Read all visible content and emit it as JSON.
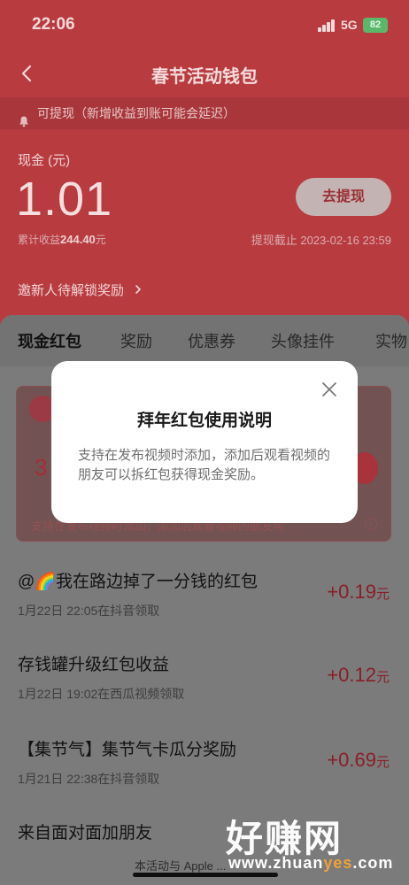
{
  "status_bar": {
    "time": "22:06",
    "network": "5G",
    "battery": "82"
  },
  "nav": {
    "title": "春节活动钱包"
  },
  "notice": {
    "text": "可提现（新增收益到账可能会延迟）"
  },
  "wallet": {
    "cash_label": "现金 (元)",
    "cash_amount": "1.01",
    "withdraw_label": "去提现",
    "total_label": "累计收益",
    "total_value": "244.40",
    "total_unit": "元",
    "deadline": "提现截止 2023-02-16 23:59",
    "invite": "邀新人待解锁奖励"
  },
  "tabs": [
    "现金红包",
    "奖励",
    "优惠券",
    "头像挂件",
    "实物"
  ],
  "card": {
    "number": "3",
    "desc": "支持在发布视频时添加，添加后观看视频的朋友可..."
  },
  "records": [
    {
      "title": "@🌈我在路边掉了一分钱的红包",
      "sub": "1月22日 22:05在抖音领取",
      "amount": "+0.19",
      "unit": "元"
    },
    {
      "title": "存钱罐升级红包收益",
      "sub": "1月22日 19:02在西瓜视频领取",
      "amount": "+0.12",
      "unit": "元"
    },
    {
      "title": "【集节气】集节气卡瓜分奖励",
      "sub": "1月21日 22:38在抖音领取",
      "amount": "+0.69",
      "unit": "元"
    },
    {
      "title": "来自面对面加朋友",
      "sub": "",
      "amount": "",
      "unit": ""
    }
  ],
  "footer": {
    "text": "本活动与 Apple ..."
  },
  "modal": {
    "title": "拜年红包使用说明",
    "body": "支持在发布视频时添加，添加后观看视频的朋友可以拆红包获得现金奖励。"
  },
  "watermark": {
    "text": "好赚网",
    "url_prefix": "www.zhuan",
    "url_highlight": "yes",
    "url_suffix": ".com"
  }
}
